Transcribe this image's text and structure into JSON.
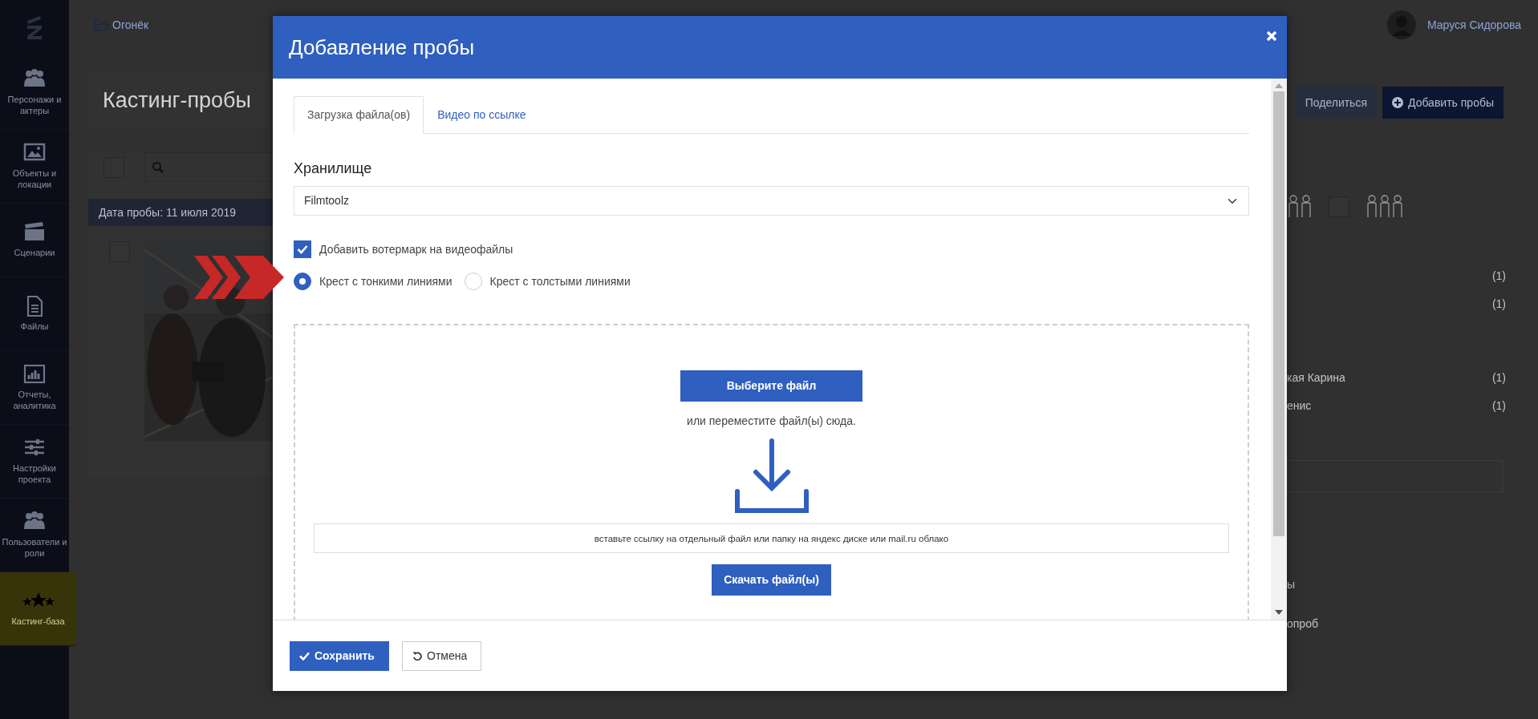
{
  "sidebar": {
    "items": [
      {
        "label": "Персонажи и актеры",
        "selected": false
      },
      {
        "label": "Объекты и локации",
        "selected": false
      },
      {
        "label": "Сценарии",
        "selected": false
      },
      {
        "label": "Файлы",
        "selected": false
      },
      {
        "label": "Отчеты, аналитика",
        "selected": false
      },
      {
        "label": "Настройки проекта",
        "selected": false
      },
      {
        "label": "Пользователи и роли",
        "selected": false
      },
      {
        "label": "Кастинг-база",
        "selected": true
      }
    ]
  },
  "project": {
    "name": "Огонёк"
  },
  "user": {
    "name": "Маруся Сидорова"
  },
  "page": {
    "title": "Кастинг-пробы",
    "actions": [
      {
        "label": "Поделиться",
        "kind": "secondary"
      },
      {
        "label": "Добавить пробы",
        "kind": "primary"
      }
    ]
  },
  "toolbar": {
    "select_all_checked": false
  },
  "date_group": "Дата пробы: 11 июля 2019",
  "crowd_filter": {
    "checked": false
  },
  "filter_groups": [
    {
      "items": [
        {
          "count": "(1)"
        },
        {
          "count": "(1)"
        }
      ]
    },
    {
      "items": [
        {
          "label": "кая Карина",
          "count": "(1)"
        },
        {
          "label": "енис",
          "count": "(1)"
        }
      ]
    }
  ],
  "side_labels": [
    "ы",
    "опроб"
  ],
  "modal": {
    "title": "Добавление пробы",
    "tabs": [
      {
        "label": "Загрузка файла(ов)",
        "selected": true
      },
      {
        "label": "Видео по ссылке",
        "selected": false
      }
    ],
    "storage": {
      "label": "Хранилище",
      "value": "Filmtoolz"
    },
    "watermark": {
      "label": "Добавить вотермарк на видеофайлы",
      "checked": true
    },
    "cross_styles": [
      {
        "label": "Крест с тонкими линиями",
        "selected": true
      },
      {
        "label": "Крест с толстыми линиями",
        "selected": false
      }
    ],
    "dropzone": {
      "choose_button": "Выберите файл",
      "hint": "или переместите файл(ы) сюда.",
      "link_field": {
        "placeholder": "вставьте ссылку на отдельный файл или папку на яндекс диске или mail.ru облако"
      },
      "download_button": "Скачать файл(ы)"
    },
    "footer_buttons": [
      {
        "label": "Сохранить",
        "kind": "primary"
      },
      {
        "label": "Отмена",
        "kind": "secondary"
      }
    ]
  }
}
